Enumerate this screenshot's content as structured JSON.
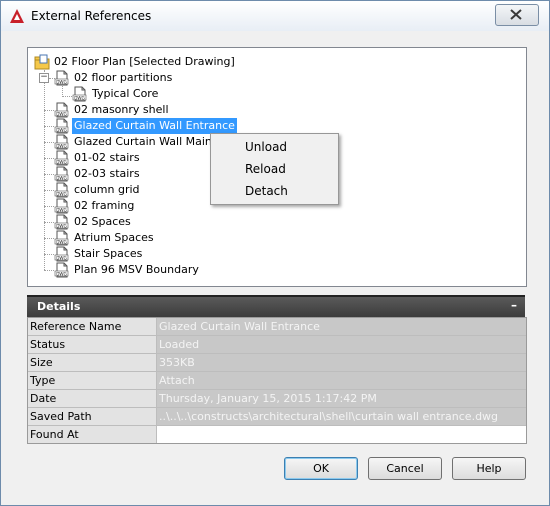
{
  "window": {
    "title": "External References"
  },
  "tree": {
    "root": "02 Floor Plan [Selected Drawing]",
    "items": [
      {
        "label": "02 floor partitions",
        "level": 1,
        "expanded": true
      },
      {
        "label": "Typical Core",
        "level": 2
      },
      {
        "label": "02 masonry shell",
        "level": 1
      },
      {
        "label": "Glazed Curtain Wall Entrance",
        "level": 1,
        "selected": true
      },
      {
        "label": "Glazed Curtain Wall Main",
        "level": 1
      },
      {
        "label": "01-02 stairs",
        "level": 1
      },
      {
        "label": "02-03 stairs",
        "level": 1
      },
      {
        "label": "column grid",
        "level": 1
      },
      {
        "label": "02 framing",
        "level": 1
      },
      {
        "label": "02 Spaces",
        "level": 1
      },
      {
        "label": "Atrium Spaces",
        "level": 1
      },
      {
        "label": "Stair Spaces",
        "level": 1
      },
      {
        "label": "Plan 96 MSV Boundary",
        "level": 1
      }
    ],
    "file_icon_text": "DWG",
    "collapse_glyph": "−"
  },
  "context_menu": {
    "items": [
      "Unload",
      "Reload",
      "Detach"
    ]
  },
  "details": {
    "title": "Details",
    "collapse_glyph": "–",
    "rows": [
      {
        "key": "Reference Name",
        "value": "Glazed Curtain Wall Entrance"
      },
      {
        "key": "Status",
        "value": "Loaded"
      },
      {
        "key": "Size",
        "value": "353KB"
      },
      {
        "key": "Type",
        "value": "Attach"
      },
      {
        "key": "Date",
        "value": "Thursday, January 15, 2015  1:17:42 PM"
      },
      {
        "key": "Saved Path",
        "value": "..\\..\\..\\constructs\\architectural\\shell\\curtain wall entrance.dwg"
      },
      {
        "key": "Found At",
        "value": ""
      }
    ]
  },
  "buttons": {
    "ok": "OK",
    "cancel": "Cancel",
    "help": "Help"
  },
  "colors": {
    "selection": "#3399ff",
    "details_header": "#4a4a4a",
    "app_icon": "#c8202a"
  }
}
